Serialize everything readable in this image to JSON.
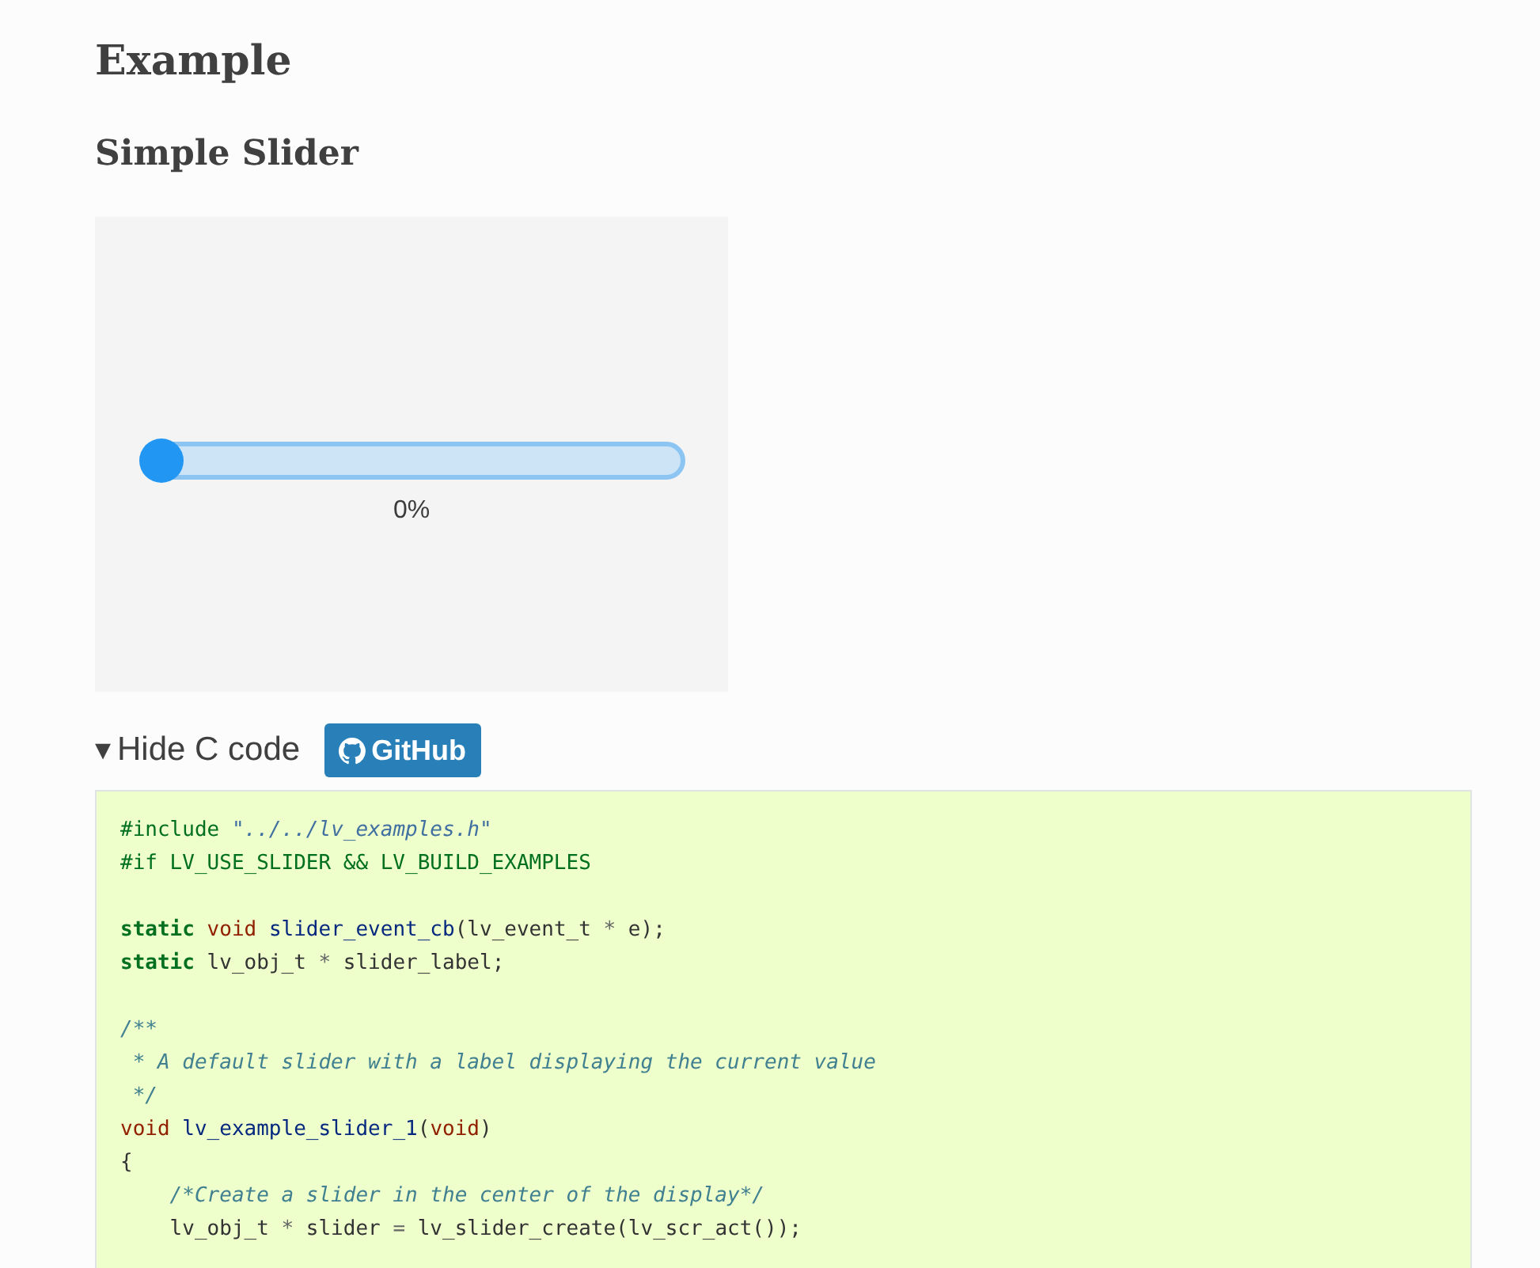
{
  "title": "Example",
  "section_title": "Simple Slider",
  "demo": {
    "slider": {
      "level": 0
    },
    "reading": "0%"
  },
  "code_toggle": {
    "icon": "▾",
    "label": "Hide C code",
    "expanded": true
  },
  "github_button": {
    "label": "GitHub"
  },
  "code_lines": [
    {
      "kind": "code",
      "tokens": [
        {
          "text": "#include ",
          "kind": "pre"
        },
        {
          "text": "\"../../lv_examples.h\"",
          "kind": "str"
        }
      ]
    },
    {
      "kind": "code",
      "tokens": [
        {
          "text": "#if LV_USE_SLIDER && LV_BUILD_EXAMPLES",
          "kind": "pre"
        }
      ]
    },
    {
      "kind": "blank"
    },
    {
      "kind": "code",
      "tokens": [
        {
          "text": "static",
          "kind": "kw"
        },
        {
          "text": " void ",
          "kind": "type"
        },
        {
          "text": "slider_event_cb",
          "kind": "func"
        },
        {
          "text": "(lv_event_t ",
          "kind": "plain"
        },
        {
          "text": "*",
          "kind": "op"
        },
        {
          "text": " e);",
          "kind": "plain"
        }
      ]
    },
    {
      "kind": "code",
      "tokens": [
        {
          "text": "static",
          "kind": "kw"
        },
        {
          "text": " lv_obj_t ",
          "kind": "plain"
        },
        {
          "text": "*",
          "kind": "op"
        },
        {
          "text": " slider_label;",
          "kind": "plain"
        }
      ]
    },
    {
      "kind": "blank"
    },
    {
      "kind": "code",
      "tokens": [
        {
          "text": "/**",
          "kind": "comment"
        }
      ]
    },
    {
      "kind": "code",
      "tokens": [
        {
          "text": " * A default slider with a label displaying the current value",
          "kind": "comment"
        }
      ]
    },
    {
      "kind": "code",
      "tokens": [
        {
          "text": " */",
          "kind": "comment"
        }
      ]
    },
    {
      "kind": "code",
      "tokens": [
        {
          "text": "void ",
          "kind": "type"
        },
        {
          "text": "lv_example_slider_1",
          "kind": "func"
        },
        {
          "text": "(",
          "kind": "plain"
        },
        {
          "text": "void",
          "kind": "type"
        },
        {
          "text": ")",
          "kind": "plain"
        }
      ]
    },
    {
      "kind": "code",
      "tokens": [
        {
          "text": "{",
          "kind": "plain"
        }
      ]
    },
    {
      "kind": "code",
      "tokens": [
        {
          "text": "    /*Create a slider in the center of the display*/",
          "kind": "comment"
        }
      ]
    },
    {
      "kind": "code",
      "tokens": [
        {
          "text": "    lv_obj_t ",
          "kind": "plain"
        },
        {
          "text": "*",
          "kind": "op"
        },
        {
          "text": " slider ",
          "kind": "plain"
        },
        {
          "text": "=",
          "kind": "op"
        },
        {
          "text": " lv_slider_create(lv_scr_act());",
          "kind": "plain"
        }
      ]
    }
  ]
}
